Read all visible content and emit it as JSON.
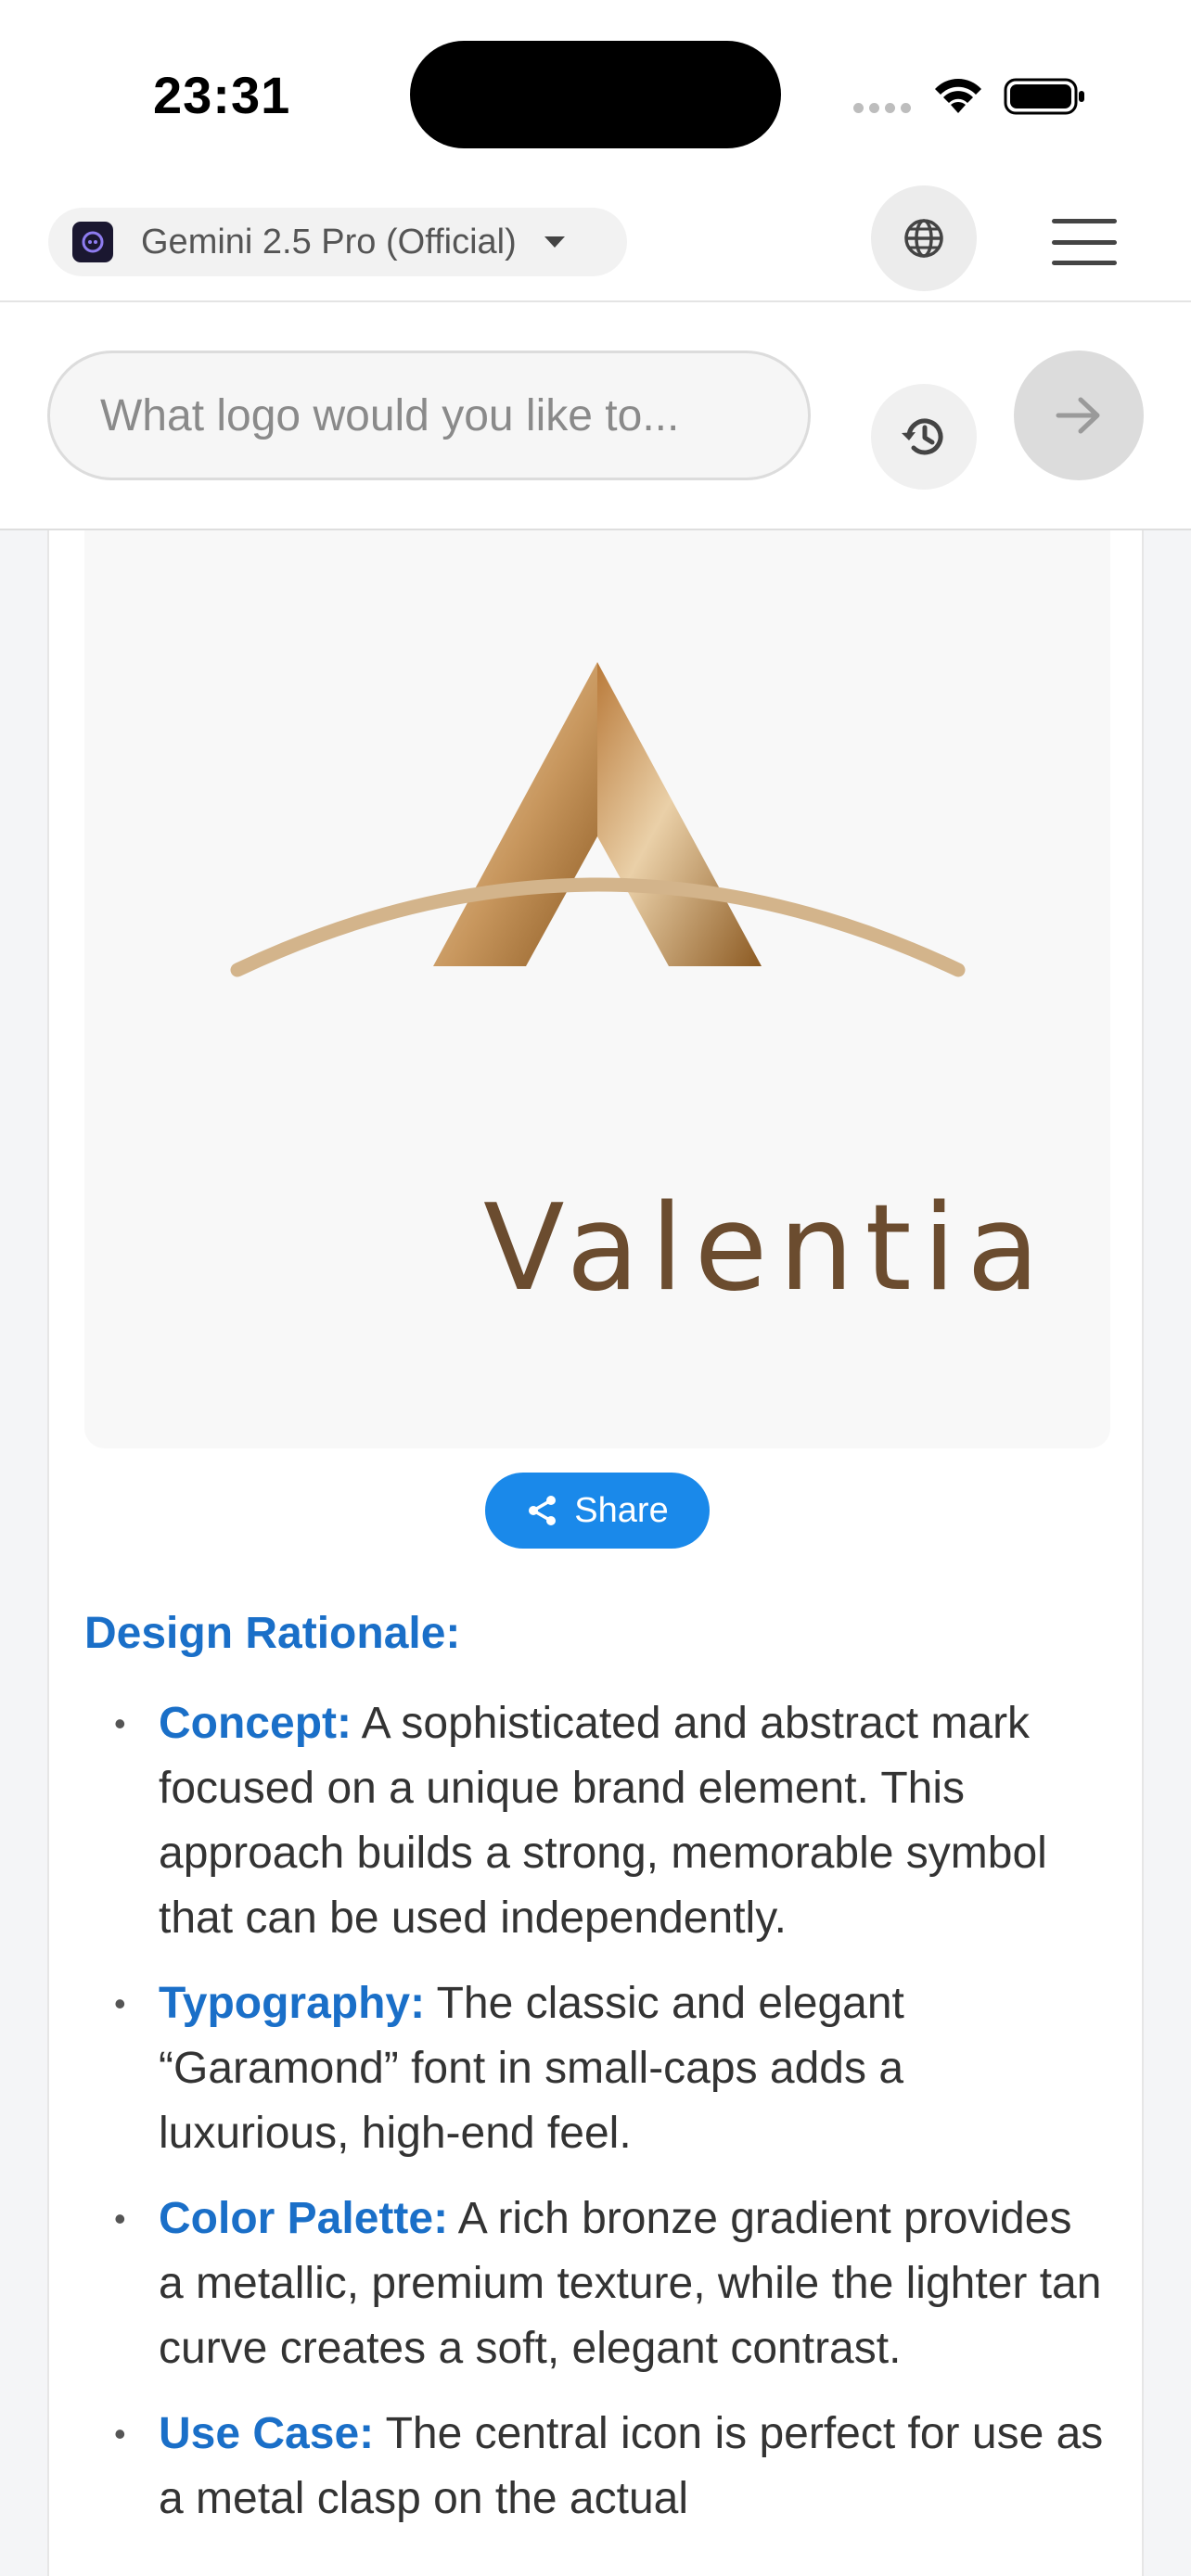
{
  "status_bar": {
    "time": "23:31"
  },
  "top_bar": {
    "model_name": "Gemini 2.5 Pro (Official)"
  },
  "search": {
    "placeholder": "What logo would you like to..."
  },
  "logo": {
    "wordmark": "Valentia"
  },
  "share": {
    "label": "Share"
  },
  "rationale": {
    "title": "Design Rationale:",
    "items": [
      {
        "term": "Concept:",
        "text": " A sophisticated and abstract mark focused on a unique brand element. This approach builds a strong, memorable symbol that can be used independently."
      },
      {
        "term": "Typography:",
        "text": " The classic and elegant “Garamond” font in small-caps adds a luxurious, high-end feel."
      },
      {
        "term": "Color Palette:",
        "text": " A rich bronze gradient provides a metallic, premium texture, while the lighter tan curve creates a soft, elegant contrast."
      },
      {
        "term": "Use Case:",
        "text": " The central icon is perfect for use as a metal clasp on the actual"
      }
    ]
  },
  "colors": {
    "accent_blue": "#1a89ea",
    "heading_blue": "#1a6fc8",
    "bronze_dark": "#8c5a22",
    "bronze_light": "#ead0a8",
    "tan_curve": "#d3b48b",
    "wordmark_brown": "#6b4c2f"
  },
  "icons": [
    "model-app-icon",
    "caret-down-icon",
    "globe-icon",
    "menu-icon",
    "history-icon",
    "arrow-right-icon",
    "share-icon"
  ]
}
